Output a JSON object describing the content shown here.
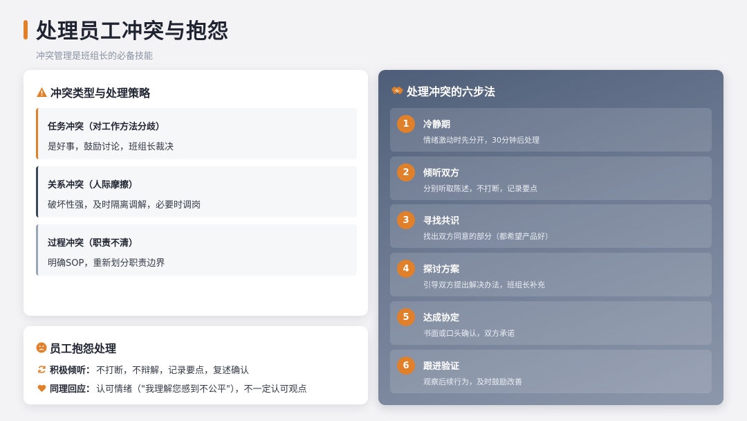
{
  "header": {
    "title": "处理员工冲突与抱怨",
    "subtitle": "冲突管理是班组长的必备技能",
    "accent_color": "#e0802a"
  },
  "conflict_types": {
    "heading": "冲突类型与处理策略",
    "icon": "warning-icon",
    "items": [
      {
        "name": "任务冲突（对工作方法分歧）",
        "desc": "是好事，鼓励讨论，班组长裁决",
        "border_color": "#e0802a"
      },
      {
        "name": "关系冲突（人际摩擦）",
        "desc": "破坏性强，及时隔离调解，必要时调岗",
        "border_color": "#3b4658"
      },
      {
        "name": "过程冲突（职责不清）",
        "desc": "明确SOP，重新划分职责边界",
        "border_color": "#9aa6b8"
      }
    ]
  },
  "complaints": {
    "heading": "员工抱怨处理",
    "icon": "angry-face-icon",
    "rows": [
      {
        "icon": "refresh-icon",
        "label": "积极倾听：",
        "text": "不打断，不辩解，记录要点，复述确认"
      },
      {
        "icon": "heart-icon",
        "label": "同理回应：",
        "text": "认可情绪（\"我理解您感到不公平\"），不一定认可观点"
      }
    ]
  },
  "six_steps": {
    "heading": "处理冲突的六步法",
    "icon": "handshake-icon",
    "steps": [
      {
        "num": "1",
        "title": "冷静期",
        "desc": "情绪激动时先分开，30分钟后处理"
      },
      {
        "num": "2",
        "title": "倾听双方",
        "desc": "分别听取陈述，不打断，记录要点"
      },
      {
        "num": "3",
        "title": "寻找共识",
        "desc": "找出双方同意的部分（都希望产品好）"
      },
      {
        "num": "4",
        "title": "探讨方案",
        "desc": "引导双方提出解决办法，班组长补充"
      },
      {
        "num": "5",
        "title": "达成协定",
        "desc": "书面或口头确认，双方承诺"
      },
      {
        "num": "6",
        "title": "跟进验证",
        "desc": "观察后续行为，及时鼓励改善"
      }
    ]
  }
}
